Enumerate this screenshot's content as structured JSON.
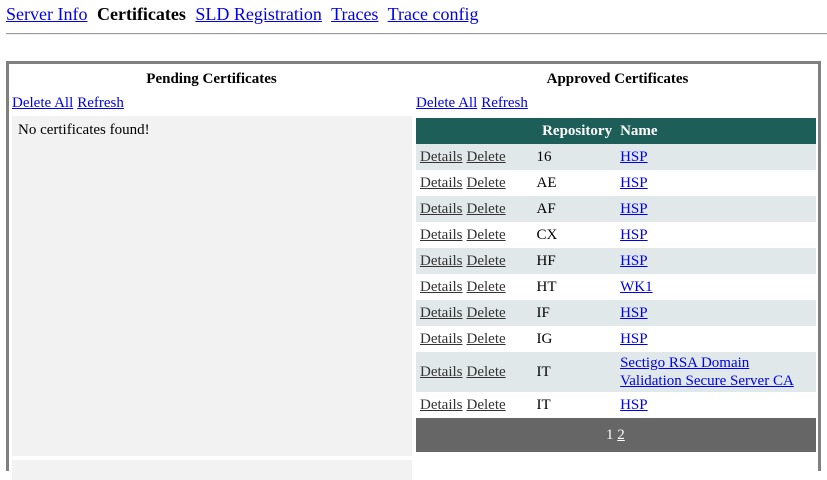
{
  "nav": {
    "items": [
      {
        "label": "Server Info",
        "current": false
      },
      {
        "label": "Certificates",
        "current": true
      },
      {
        "label": "SLD Registration",
        "current": false
      },
      {
        "label": "Traces",
        "current": false
      },
      {
        "label": "Trace config",
        "current": false
      }
    ]
  },
  "pending": {
    "title": "Pending Certificates",
    "delete_all": "Delete All",
    "refresh": "Refresh",
    "empty_message": "No certificates found!"
  },
  "approved": {
    "title": "Approved Certificates",
    "delete_all": "Delete All",
    "refresh": "Refresh",
    "columns": {
      "repository": "Repository",
      "name": "Name"
    },
    "details_label": "Details",
    "delete_label": "Delete",
    "rows": [
      {
        "repository": "16",
        "name": "HSP"
      },
      {
        "repository": "AE",
        "name": "HSP"
      },
      {
        "repository": "AF",
        "name": "HSP"
      },
      {
        "repository": "CX",
        "name": "HSP"
      },
      {
        "repository": "HF",
        "name": "HSP"
      },
      {
        "repository": "HT",
        "name": "WK1"
      },
      {
        "repository": "IF",
        "name": "HSP"
      },
      {
        "repository": "IG",
        "name": "HSP"
      },
      {
        "repository": "IT",
        "name": "Sectigo RSA Domain Validation Secure Server CA"
      },
      {
        "repository": "IT",
        "name": "HSP"
      }
    ],
    "pager": {
      "current": "1",
      "pages": [
        "2"
      ]
    }
  }
}
